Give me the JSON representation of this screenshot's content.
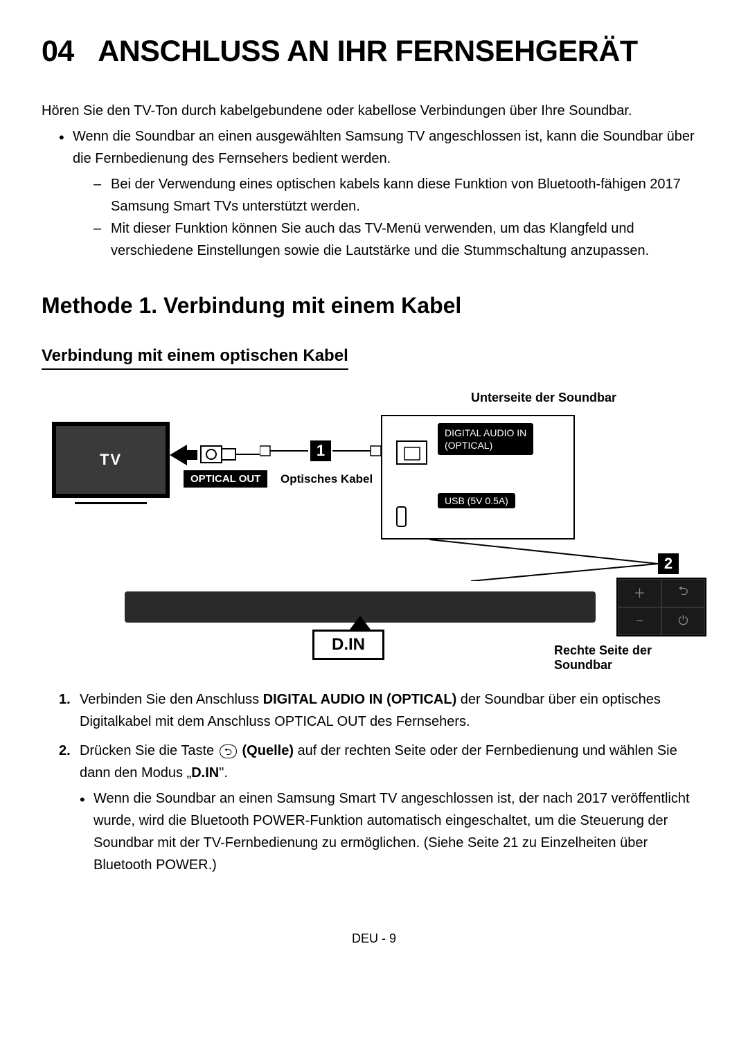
{
  "heading": {
    "number": "04",
    "title": "ANSCHLUSS AN IHR FERNSEHGERÄT"
  },
  "intro": "Hören Sie den TV-Ton durch kabelgebundene oder kabellose Verbindungen über Ihre Soundbar.",
  "bullet1": "Wenn die Soundbar an einen ausgewählten Samsung TV angeschlossen ist, kann die Soundbar über die Fernbedienung des Fernsehers bedient werden.",
  "dash1": "Bei der Verwendung eines optischen kabels kann diese Funktion von Bluetooth-fähigen 2017 Samsung Smart TVs unterstützt werden.",
  "dash2": "Mit dieser Funktion können Sie auch das TV-Menü verwenden, um das Klangfeld und verschiedene Einstellungen sowie die Lautstärke und die Stummschaltung anzupassen.",
  "method_heading": "Methode 1. Verbindung mit einem Kabel",
  "sub_heading": "Verbindung mit einem optischen Kabel",
  "diagram": {
    "top_label": "Unterseite der Soundbar",
    "tv_label": "TV",
    "optical_out": "OPTICAL OUT",
    "cable_label": "Optisches Kabel",
    "digital_audio_line1": "DIGITAL AUDIO IN",
    "digital_audio_line2": "(OPTICAL)",
    "usb_label": "USB (5V 0.5A)",
    "step1": "1",
    "step2": "2",
    "din": "D.IN",
    "side_label": "Rechte Seite der Soundbar"
  },
  "steps": {
    "s1_num": "1.",
    "s1_a": "Verbinden Sie den Anschluss ",
    "s1_b": "DIGITAL AUDIO IN (OPTICAL)",
    "s1_c": " der Soundbar über ein optisches Digitalkabel mit dem Anschluss OPTICAL OUT des Fernsehers.",
    "s2_num": "2.",
    "s2_a": "Drücken Sie die Taste ",
    "s2_icon": "⮌",
    "s2_b": " (Quelle)",
    "s2_c": " auf der rechten Seite oder der Fernbedienung und wählen Sie dann den Modus „",
    "s2_d": "D.IN",
    "s2_e": "\".",
    "s2_sub": "Wenn die Soundbar an einen Samsung Smart TV angeschlossen ist, der nach 2017 veröffentlicht wurde, wird die Bluetooth POWER-Funktion automatisch eingeschaltet, um die Steuerung der Soundbar mit der TV-Fernbedienung zu ermöglichen. (Siehe Seite 21 zu Einzelheiten über Bluetooth POWER.)"
  },
  "footer": "DEU - 9"
}
